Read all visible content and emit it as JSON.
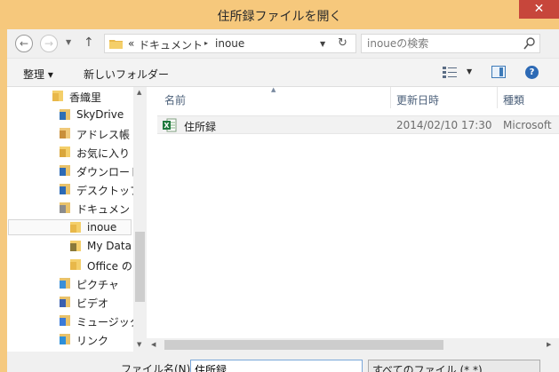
{
  "window": {
    "title": "住所録ファイルを開く",
    "close_glyph": "✕"
  },
  "nav": {
    "back_glyph": "←",
    "forward_glyph": "→",
    "up_glyph": "↑",
    "address": {
      "prefix": "«",
      "segments": [
        "ドキュメント",
        "inoue"
      ],
      "refresh_glyph": "↻"
    },
    "search": {
      "placeholder": "inoueの検索"
    }
  },
  "toolbar": {
    "organize_label": "整理 ▾",
    "new_folder_label": "新しいフォルダー",
    "help_glyph": "?"
  },
  "tree": [
    {
      "label": "香織里",
      "icon": "folder-icon"
    },
    {
      "label": "SkyDrive",
      "icon": "skydrive-icon"
    },
    {
      "label": "アドレス帳",
      "icon": "contacts-icon"
    },
    {
      "label": "お気に入り",
      "icon": "favorites-icon"
    },
    {
      "label": "ダウンロード",
      "icon": "downloads-icon"
    },
    {
      "label": "デスクトップ",
      "icon": "desktop-icon"
    },
    {
      "label": "ドキュメント",
      "icon": "documents-icon"
    },
    {
      "label": "inoue",
      "icon": "folder-icon"
    },
    {
      "label": "My Data",
      "icon": "mydata-folder-icon"
    },
    {
      "label": "Office の",
      "icon": "folder-icon"
    },
    {
      "label": "ピクチャ",
      "icon": "pictures-icon"
    },
    {
      "label": "ビデオ",
      "icon": "videos-icon"
    },
    {
      "label": "ミュージック",
      "icon": "music-icon"
    },
    {
      "label": "リンク",
      "icon": "links-icon"
    }
  ],
  "columns": {
    "name": "名前",
    "date": "更新日時",
    "type": "種類"
  },
  "files": [
    {
      "name": "住所録",
      "date": "2014/02/10 17:30",
      "type": "Microsoft",
      "icon": "excel-icon"
    }
  ],
  "footer": {
    "filename_label": "ファイル名(N):",
    "filename_value": "住所録",
    "filetype_value": "すべてのファイル (*.*)"
  },
  "colors": {
    "titlebar": "#f6c87c",
    "close": "#c7463b",
    "selection_border": "#7aa7d9"
  }
}
